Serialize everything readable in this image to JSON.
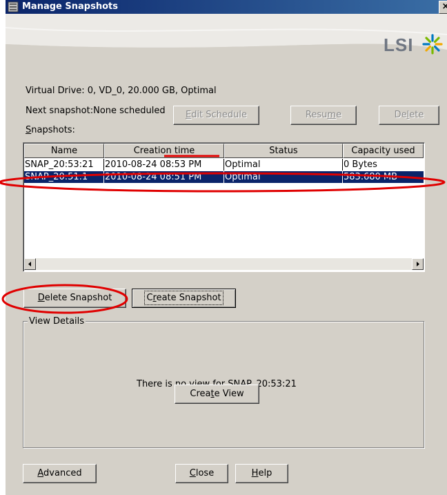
{
  "window": {
    "title": "Manage Snapshots",
    "close_glyph": "×"
  },
  "banner": {
    "logo_text": "LSI"
  },
  "info": {
    "virtual_drive": "Virtual Drive: 0, VD_0, 20.000 GB, Optimal",
    "next_snapshot": "Next snapshot:None scheduled"
  },
  "schedule_buttons": {
    "edit_schedule": {
      "pre": "",
      "key": "E",
      "post": "dit Schedule"
    },
    "resume": {
      "pre": "Resu",
      "key": "m",
      "post": "e"
    },
    "delete": {
      "pre": "De",
      "key": "l",
      "post": "ete"
    }
  },
  "snapshots_label": {
    "key": "S",
    "rest": "napshots:"
  },
  "table": {
    "columns": [
      "Name",
      "Creation time",
      "Status",
      "Capacity used"
    ],
    "rows": [
      {
        "name": "SNAP_20:53:21",
        "creation_time": "2010-08-24 08:53 PM",
        "status": "Optimal",
        "capacity": "0 Bytes",
        "selected": false
      },
      {
        "name": "SNAP_20:51:1",
        "creation_time": "2010-08-24 08:51 PM",
        "status": "Optimal",
        "capacity": "583.680 MB",
        "selected": true
      }
    ]
  },
  "action_buttons": {
    "delete_snapshot": {
      "key": "D",
      "rest": "elete Snapshot"
    },
    "create_snapshot": {
      "pre": "C",
      "key": "r",
      "post": "eate Snapshot"
    }
  },
  "view_details": {
    "title": "View Details",
    "message": "There is no view for SNAP_20:53:21",
    "create_view": {
      "pre": "Crea",
      "key": "t",
      "post": "e View"
    }
  },
  "footer_buttons": {
    "advanced": {
      "key": "A",
      "rest": "dvanced"
    },
    "close": {
      "key": "C",
      "rest": "lose"
    },
    "help": {
      "key": "H",
      "rest": "elp"
    }
  },
  "colors": {
    "title_bar": "#0a246a",
    "selection": "#0a246a",
    "annotation_red": "#e00000",
    "dialog_face": "#d4d0c8"
  }
}
